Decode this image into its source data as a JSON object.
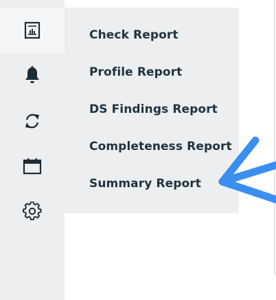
{
  "sidebar": {
    "items": [
      {
        "icon": "report-icon",
        "active": true
      },
      {
        "icon": "bell-icon",
        "active": false
      },
      {
        "icon": "refresh-icon",
        "active": false
      },
      {
        "icon": "calendar-icon",
        "active": false
      },
      {
        "icon": "gear-icon",
        "active": false
      }
    ]
  },
  "reports_menu": {
    "items": [
      {
        "label": "Check Report"
      },
      {
        "label": "Profile Report"
      },
      {
        "label": "DS Findings Report"
      },
      {
        "label": "Completeness Report"
      },
      {
        "label": "Summary Report"
      }
    ]
  },
  "colors": {
    "sidebar_bg": "#eceef0",
    "active_item_bg": "#f5f6f7",
    "menu_text": "#20333f",
    "icon": "#1e2b35",
    "annotation_arrow": "#3a8ef0"
  }
}
